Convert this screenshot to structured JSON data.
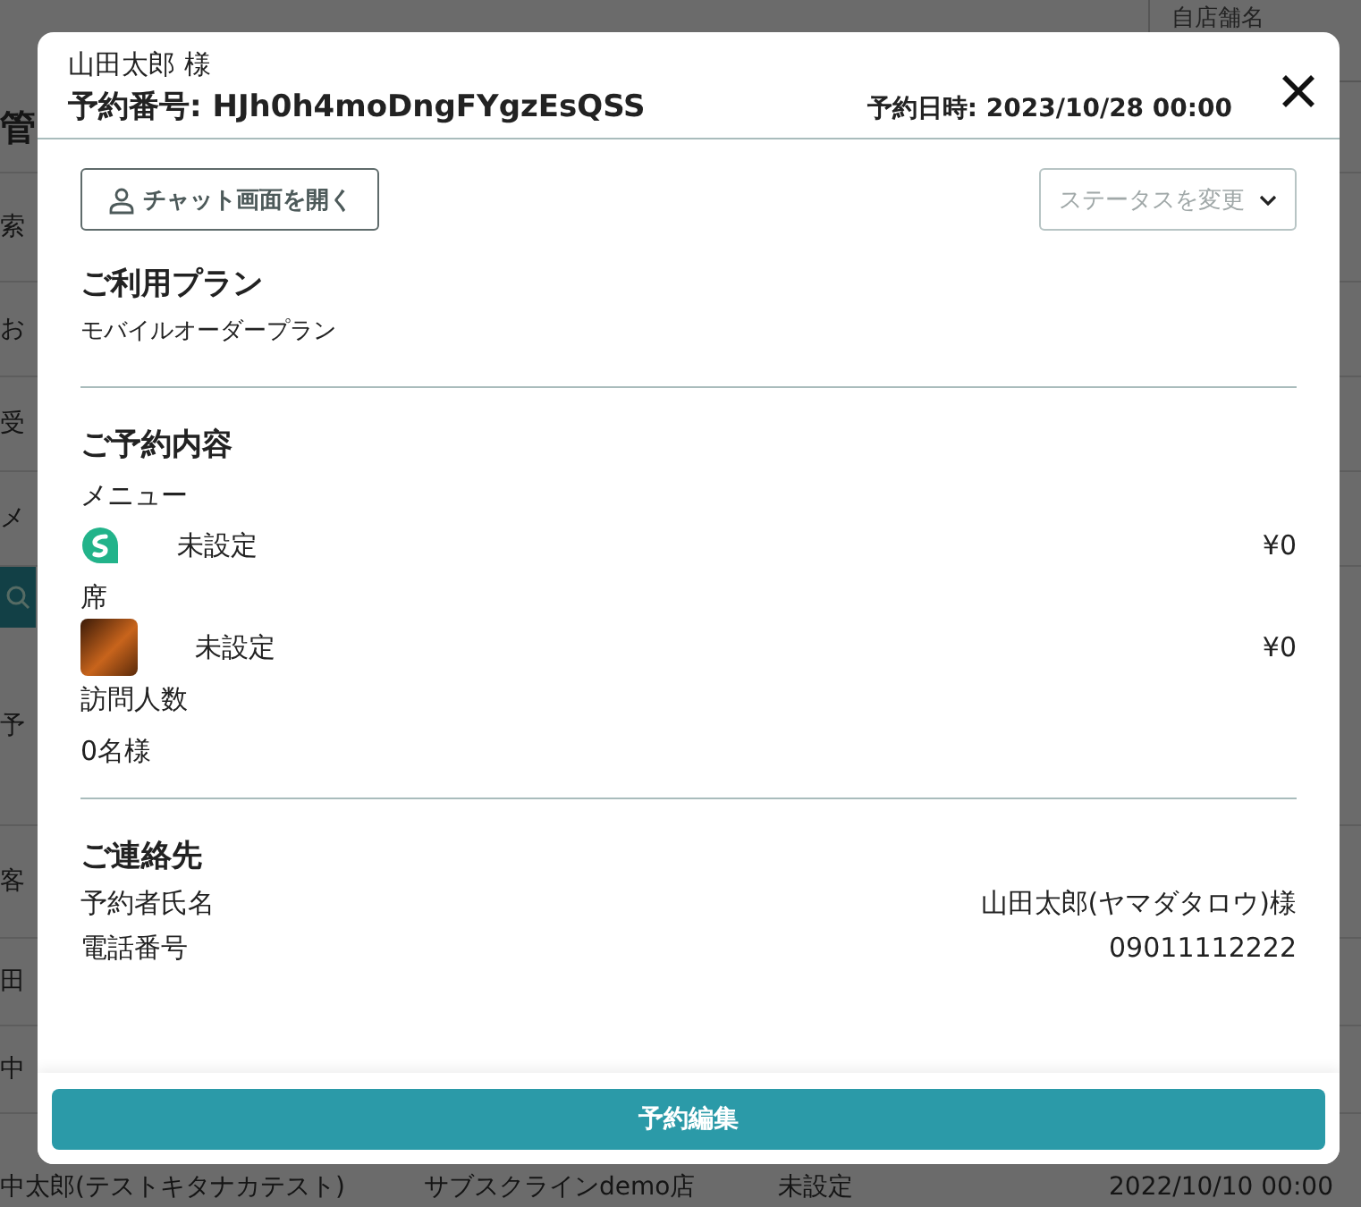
{
  "background": {
    "header_label": "自店舗名",
    "page_title": "管",
    "left_fragments": [
      "索",
      "お",
      "受",
      "メ",
      "予",
      "客",
      "田",
      "中"
    ],
    "last_row": [
      "中太郎(テストキタナカテスト)",
      "サブスクラインdemo店",
      "未設定",
      "2022/10/10 00:00"
    ]
  },
  "dialog": {
    "customer": "山田太郎 様",
    "reservation_number": "予約番号: HJh0h4moDngFYgzEsQSS",
    "reservation_datetime": "予約日時: 2023/10/28 00:00",
    "chat_button": "チャット画面を開く",
    "status_select": {
      "placeholder": "ステータスを変更"
    },
    "plan": {
      "title": "ご利用プラン",
      "text": "モバイルオーダープラン"
    },
    "reservation": {
      "title": "ご予約内容",
      "groups": [
        {
          "label": "メニュー",
          "items": [
            {
              "kind": "logo",
              "name": "未設定",
              "price": "¥0"
            }
          ]
        },
        {
          "label": "席",
          "items": [
            {
              "kind": "photo",
              "name": "未設定",
              "price": "¥0"
            }
          ]
        },
        {
          "label": "訪問人数",
          "value": "0名様"
        }
      ]
    },
    "contact": {
      "title": "ご連絡先",
      "rows": [
        {
          "label": "予約者氏名",
          "value": "山田太郎(ヤマダタロウ)様"
        },
        {
          "label": "電話番号",
          "value": "09011112222"
        }
      ]
    },
    "edit_button": "予約編集"
  }
}
